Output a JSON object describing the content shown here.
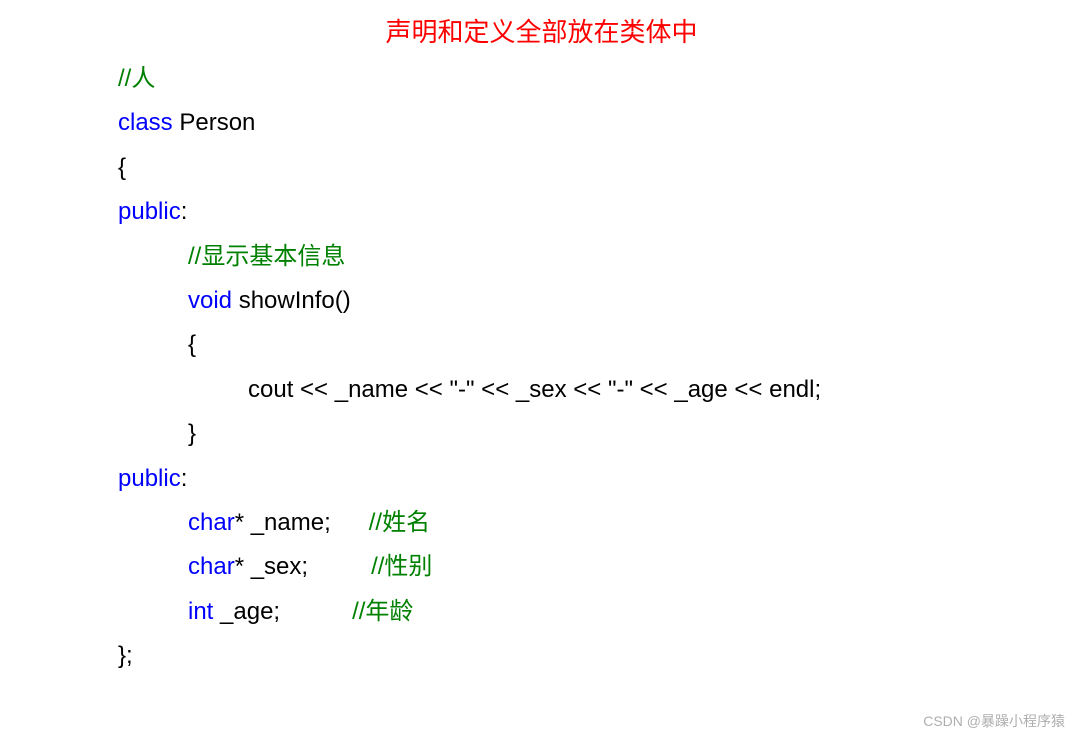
{
  "title": "声明和定义全部放在类体中",
  "code": {
    "comment_person": "//人",
    "class_kw": "class ",
    "class_name": "Person",
    "brace_open": "{",
    "public1": "public",
    "colon1": ":",
    "comment_showinfo": "//显示基本信息",
    "void_kw": "void ",
    "method_name": "showInfo()",
    "brace_open2": "{",
    "cout_line": "cout << _name << \"-\" << _sex << \"-\" << _age << endl;",
    "brace_close2": "}",
    "public2": "public",
    "colon2": ":",
    "char_kw1": "char",
    "name_decl": "* _name;",
    "comment_name": "//姓名",
    "char_kw2": "char",
    "sex_decl": "* _sex;",
    "comment_sex": "//性别",
    "int_kw": "int",
    "age_decl": "   _age;",
    "comment_age": "//年龄",
    "brace_close": "};"
  },
  "watermark": "CSDN @暴躁小程序猿"
}
